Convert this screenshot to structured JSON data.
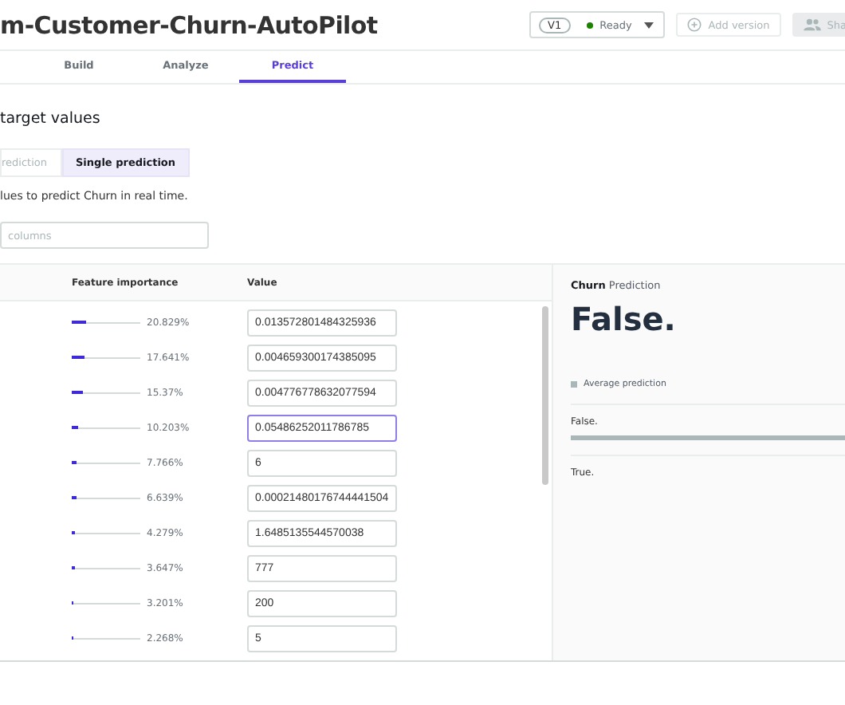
{
  "header": {
    "title": "m-Customer-Churn-AutoPilot",
    "version": {
      "label": "V1",
      "status": "Ready"
    },
    "buttons": [
      {
        "label": "Add version",
        "kind": "add",
        "disabled": true
      },
      {
        "label": "Sha",
        "kind": "share",
        "disabled": true
      }
    ]
  },
  "tabs": [
    {
      "label": "Build",
      "selected": false
    },
    {
      "label": "Analyze",
      "selected": false
    },
    {
      "label": "Predict",
      "selected": true
    }
  ],
  "section_title": "target values",
  "mode_tabs": [
    {
      "label": "rediction",
      "selected": false
    },
    {
      "label": "Single prediction",
      "selected": true
    }
  ],
  "description": "lues to predict Churn in real time.",
  "search": {
    "placeholder": "columns"
  },
  "table": {
    "columns": [
      "Feature importance",
      "Value"
    ],
    "rows": [
      {
        "importance": "20.829%",
        "level": 0.20829,
        "value": "0.013572801484325936",
        "focused": false
      },
      {
        "importance": "17.641%",
        "level": 0.17641,
        "value": "0.004659300174385095",
        "focused": false
      },
      {
        "importance": "15.37%",
        "level": 0.1537,
        "value": "0.004776778632077594",
        "focused": false
      },
      {
        "importance": "10.203%",
        "level": 0.10203,
        "value": "0.05486252011786785",
        "focused": true
      },
      {
        "importance": "7.766%",
        "level": 0.07766,
        "value": "6",
        "focused": false
      },
      {
        "importance": "6.639%",
        "level": 0.06639,
        "value": "0.00021480176744441504",
        "focused": false
      },
      {
        "importance": "4.279%",
        "level": 0.04279,
        "value": "1.6485135544570038",
        "focused": false
      },
      {
        "importance": "3.647%",
        "level": 0.03647,
        "value": "777",
        "focused": false
      },
      {
        "importance": "3.201%",
        "level": 0.03201,
        "value": "200",
        "focused": false
      },
      {
        "importance": "2.268%",
        "level": 0.02268,
        "value": "5",
        "focused": false
      }
    ]
  },
  "prediction": {
    "target": "Churn",
    "label": "Prediction",
    "result": "False.",
    "legend": "Average prediction",
    "classes": [
      {
        "label": "False.",
        "level": 1
      },
      {
        "label": "True."
      }
    ]
  }
}
